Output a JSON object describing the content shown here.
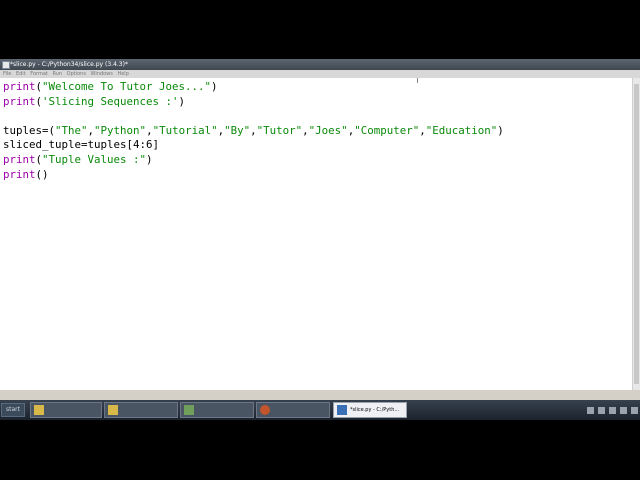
{
  "window": {
    "title": "*slice.py - C:/Python34/slice.py (3.4.3)*",
    "menu": [
      "File",
      "Edit",
      "Format",
      "Run",
      "Options",
      "Windows",
      "Help"
    ]
  },
  "editor": {
    "lines": [
      [
        {
          "t": "print",
          "c": "kw"
        },
        {
          "t": "(",
          "c": "p"
        },
        {
          "t": "\"Welcome To Tutor Joes...\"",
          "c": "str"
        },
        {
          "t": ")",
          "c": "p"
        }
      ],
      [
        {
          "t": "print",
          "c": "kw"
        },
        {
          "t": "(",
          "c": "p"
        },
        {
          "t": "'Slicing Sequences :'",
          "c": "str"
        },
        {
          "t": ")",
          "c": "p"
        }
      ],
      [],
      [
        {
          "t": "tuples=(",
          "c": "p"
        },
        {
          "t": "\"The\"",
          "c": "str"
        },
        {
          "t": ",",
          "c": "p"
        },
        {
          "t": "\"Python\"",
          "c": "str"
        },
        {
          "t": ",",
          "c": "p"
        },
        {
          "t": "\"Tutorial\"",
          "c": "str"
        },
        {
          "t": ",",
          "c": "p"
        },
        {
          "t": "\"By\"",
          "c": "str"
        },
        {
          "t": ",",
          "c": "p"
        },
        {
          "t": "\"Tutor\"",
          "c": "str"
        },
        {
          "t": ",",
          "c": "p"
        },
        {
          "t": "\"Joes\"",
          "c": "str"
        },
        {
          "t": ",",
          "c": "p"
        },
        {
          "t": "\"Computer\"",
          "c": "str"
        },
        {
          "t": ",",
          "c": "p"
        },
        {
          "t": "\"Education\"",
          "c": "str"
        },
        {
          "t": ")",
          "c": "p"
        }
      ],
      [
        {
          "t": "sliced_tuple=tuples[4:6]",
          "c": "p"
        }
      ],
      [
        {
          "t": "print",
          "c": "kw"
        },
        {
          "t": "(",
          "c": "p"
        },
        {
          "t": "\"Tuple Values :\"",
          "c": "str"
        },
        {
          "t": ")",
          "c": "p"
        }
      ],
      [
        {
          "t": "print",
          "c": "kw"
        },
        {
          "t": "()",
          "c": "p"
        }
      ]
    ]
  },
  "taskbar": {
    "start_label": "start",
    "tasks": [
      {
        "label": "",
        "icon": "folder-icon"
      },
      {
        "label": "",
        "icon": "folder-icon"
      },
      {
        "label": "",
        "icon": "picture-icon"
      },
      {
        "label": "",
        "icon": "browser-icon"
      },
      {
        "label": "*slice.py - C:/Pyth...",
        "icon": "python-icon",
        "active": true
      }
    ]
  },
  "colors": {
    "keyword": "#9c00a8",
    "string": "#0a8a0a",
    "plain": "#000000"
  }
}
